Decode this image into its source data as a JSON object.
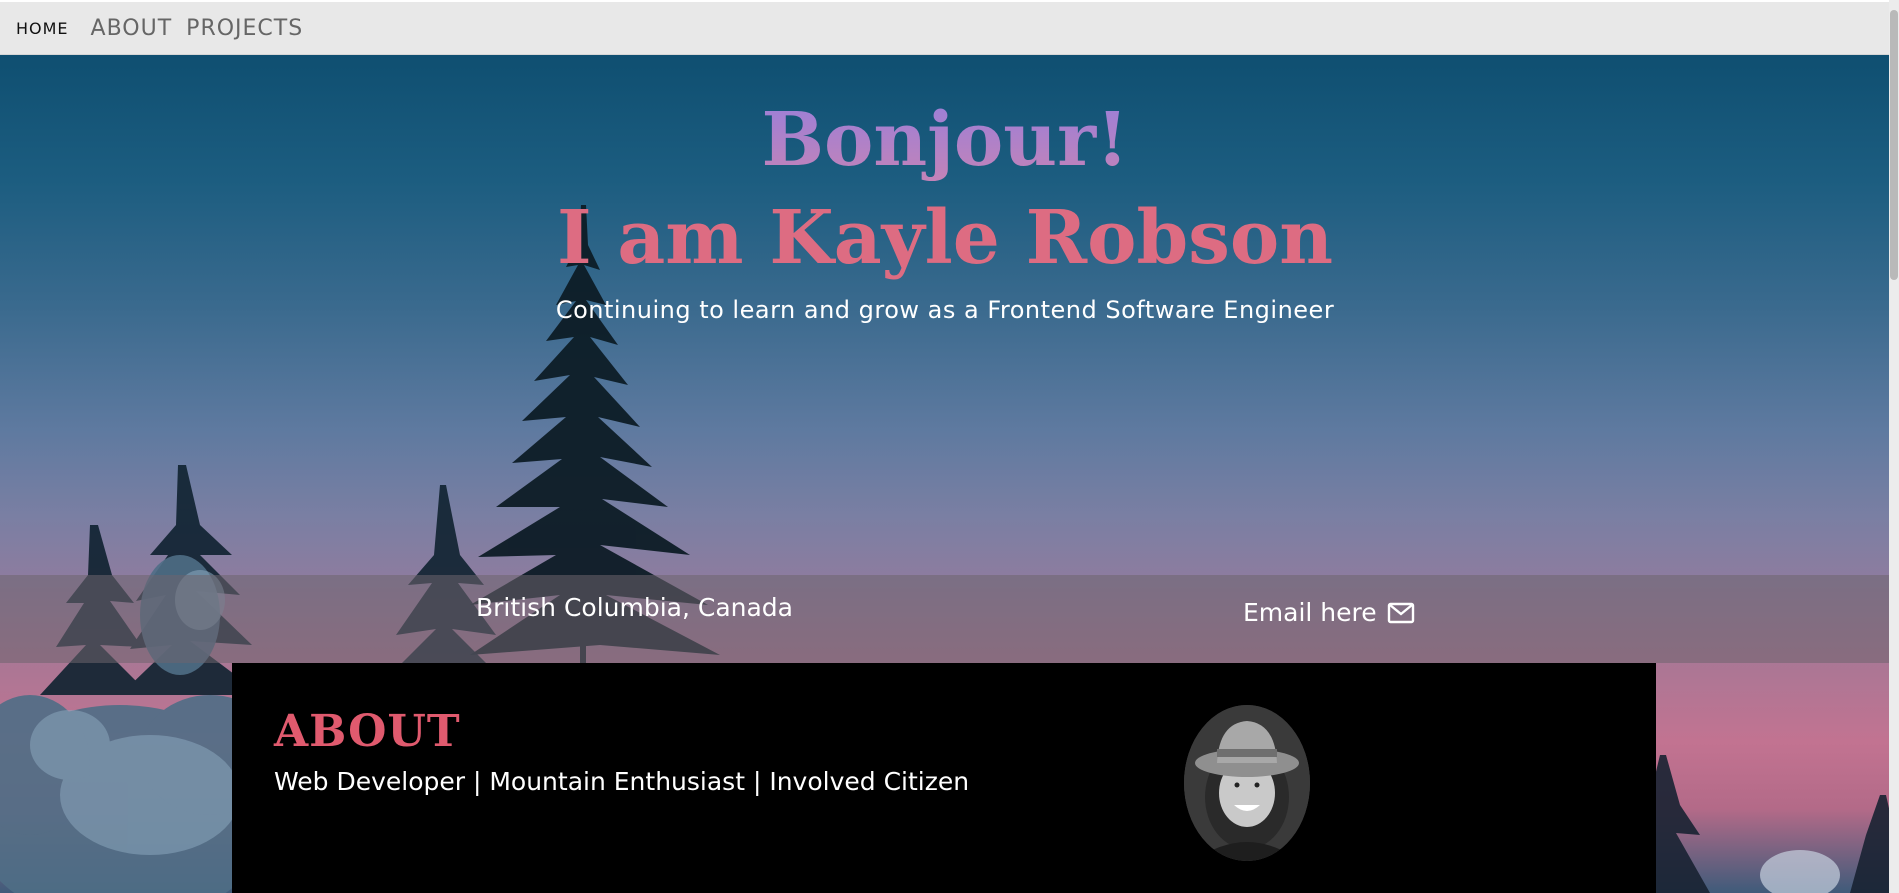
{
  "nav": {
    "home": "HOME",
    "about": "ABOUT",
    "projects": "PROJECTS"
  },
  "hero": {
    "greeting": "Bonjour!",
    "name": "I am Kayle Robson",
    "tagline": "Continuing to learn and grow as a Frontend Software Engineer"
  },
  "info": {
    "location": "British Columbia, Canada",
    "email_label": "Email here",
    "email_icon": "envelope-icon"
  },
  "about": {
    "title": "ABOUT",
    "roles": "Web Developer | Mountain Enthusiast | Involved Citizen",
    "avatar_icon": "profile-photo"
  },
  "colors": {
    "nav_bg": "#e8e8e8",
    "greeting_gradient_start": "#9b7fd8",
    "greeting_gradient_end": "#c383b8",
    "name_color": "#dd6c82",
    "about_title_color": "#e05a6e",
    "card_bg": "#000000"
  }
}
